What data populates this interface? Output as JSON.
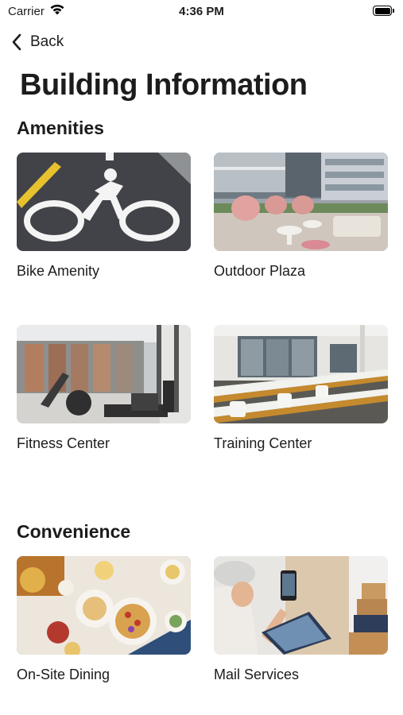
{
  "status_bar": {
    "carrier": "Carrier",
    "time": "4:36 PM"
  },
  "nav": {
    "back_label": "Back"
  },
  "page": {
    "title": "Building Information"
  },
  "sections": [
    {
      "title": "Amenities",
      "cards": [
        {
          "label": "Bike Amenity"
        },
        {
          "label": "Outdoor Plaza"
        },
        {
          "label": "Fitness Center"
        },
        {
          "label": "Training Center"
        }
      ]
    },
    {
      "title": "Convenience",
      "cards": [
        {
          "label": "On-Site Dining"
        },
        {
          "label": "Mail Services"
        }
      ]
    }
  ]
}
